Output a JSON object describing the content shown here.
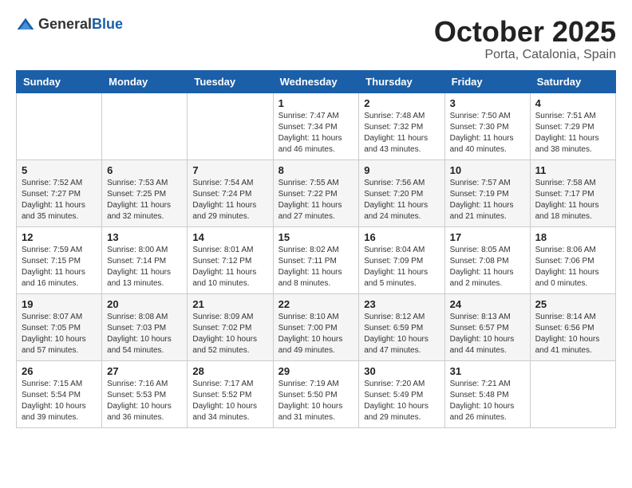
{
  "header": {
    "logo": {
      "general": "General",
      "blue": "Blue"
    },
    "month": "October 2025",
    "location": "Porta, Catalonia, Spain"
  },
  "weekdays": [
    "Sunday",
    "Monday",
    "Tuesday",
    "Wednesday",
    "Thursday",
    "Friday",
    "Saturday"
  ],
  "weeks": [
    [
      {
        "day": "",
        "info": ""
      },
      {
        "day": "",
        "info": ""
      },
      {
        "day": "",
        "info": ""
      },
      {
        "day": "1",
        "info": "Sunrise: 7:47 AM\nSunset: 7:34 PM\nDaylight: 11 hours and 46 minutes."
      },
      {
        "day": "2",
        "info": "Sunrise: 7:48 AM\nSunset: 7:32 PM\nDaylight: 11 hours and 43 minutes."
      },
      {
        "day": "3",
        "info": "Sunrise: 7:50 AM\nSunset: 7:30 PM\nDaylight: 11 hours and 40 minutes."
      },
      {
        "day": "4",
        "info": "Sunrise: 7:51 AM\nSunset: 7:29 PM\nDaylight: 11 hours and 38 minutes."
      }
    ],
    [
      {
        "day": "5",
        "info": "Sunrise: 7:52 AM\nSunset: 7:27 PM\nDaylight: 11 hours and 35 minutes."
      },
      {
        "day": "6",
        "info": "Sunrise: 7:53 AM\nSunset: 7:25 PM\nDaylight: 11 hours and 32 minutes."
      },
      {
        "day": "7",
        "info": "Sunrise: 7:54 AM\nSunset: 7:24 PM\nDaylight: 11 hours and 29 minutes."
      },
      {
        "day": "8",
        "info": "Sunrise: 7:55 AM\nSunset: 7:22 PM\nDaylight: 11 hours and 27 minutes."
      },
      {
        "day": "9",
        "info": "Sunrise: 7:56 AM\nSunset: 7:20 PM\nDaylight: 11 hours and 24 minutes."
      },
      {
        "day": "10",
        "info": "Sunrise: 7:57 AM\nSunset: 7:19 PM\nDaylight: 11 hours and 21 minutes."
      },
      {
        "day": "11",
        "info": "Sunrise: 7:58 AM\nSunset: 7:17 PM\nDaylight: 11 hours and 18 minutes."
      }
    ],
    [
      {
        "day": "12",
        "info": "Sunrise: 7:59 AM\nSunset: 7:15 PM\nDaylight: 11 hours and 16 minutes."
      },
      {
        "day": "13",
        "info": "Sunrise: 8:00 AM\nSunset: 7:14 PM\nDaylight: 11 hours and 13 minutes."
      },
      {
        "day": "14",
        "info": "Sunrise: 8:01 AM\nSunset: 7:12 PM\nDaylight: 11 hours and 10 minutes."
      },
      {
        "day": "15",
        "info": "Sunrise: 8:02 AM\nSunset: 7:11 PM\nDaylight: 11 hours and 8 minutes."
      },
      {
        "day": "16",
        "info": "Sunrise: 8:04 AM\nSunset: 7:09 PM\nDaylight: 11 hours and 5 minutes."
      },
      {
        "day": "17",
        "info": "Sunrise: 8:05 AM\nSunset: 7:08 PM\nDaylight: 11 hours and 2 minutes."
      },
      {
        "day": "18",
        "info": "Sunrise: 8:06 AM\nSunset: 7:06 PM\nDaylight: 11 hours and 0 minutes."
      }
    ],
    [
      {
        "day": "19",
        "info": "Sunrise: 8:07 AM\nSunset: 7:05 PM\nDaylight: 10 hours and 57 minutes."
      },
      {
        "day": "20",
        "info": "Sunrise: 8:08 AM\nSunset: 7:03 PM\nDaylight: 10 hours and 54 minutes."
      },
      {
        "day": "21",
        "info": "Sunrise: 8:09 AM\nSunset: 7:02 PM\nDaylight: 10 hours and 52 minutes."
      },
      {
        "day": "22",
        "info": "Sunrise: 8:10 AM\nSunset: 7:00 PM\nDaylight: 10 hours and 49 minutes."
      },
      {
        "day": "23",
        "info": "Sunrise: 8:12 AM\nSunset: 6:59 PM\nDaylight: 10 hours and 47 minutes."
      },
      {
        "day": "24",
        "info": "Sunrise: 8:13 AM\nSunset: 6:57 PM\nDaylight: 10 hours and 44 minutes."
      },
      {
        "day": "25",
        "info": "Sunrise: 8:14 AM\nSunset: 6:56 PM\nDaylight: 10 hours and 41 minutes."
      }
    ],
    [
      {
        "day": "26",
        "info": "Sunrise: 7:15 AM\nSunset: 5:54 PM\nDaylight: 10 hours and 39 minutes."
      },
      {
        "day": "27",
        "info": "Sunrise: 7:16 AM\nSunset: 5:53 PM\nDaylight: 10 hours and 36 minutes."
      },
      {
        "day": "28",
        "info": "Sunrise: 7:17 AM\nSunset: 5:52 PM\nDaylight: 10 hours and 34 minutes."
      },
      {
        "day": "29",
        "info": "Sunrise: 7:19 AM\nSunset: 5:50 PM\nDaylight: 10 hours and 31 minutes."
      },
      {
        "day": "30",
        "info": "Sunrise: 7:20 AM\nSunset: 5:49 PM\nDaylight: 10 hours and 29 minutes."
      },
      {
        "day": "31",
        "info": "Sunrise: 7:21 AM\nSunset: 5:48 PM\nDaylight: 10 hours and 26 minutes."
      },
      {
        "day": "",
        "info": ""
      }
    ]
  ]
}
